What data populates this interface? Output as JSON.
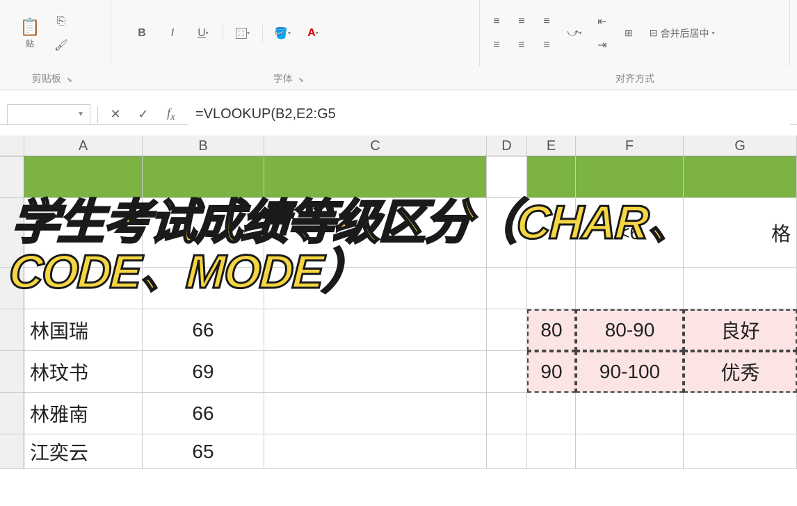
{
  "ribbon": {
    "paste_label": "贴",
    "clipboard_label": "剪贴板",
    "font_label": "字体",
    "align_label": "对齐方式",
    "bold": "B",
    "italic": "I",
    "underline": "U",
    "merge_label": "合并后居中"
  },
  "formula_bar": {
    "name_box": "",
    "formula": "=VLOOKUP(B2,E2:G5"
  },
  "columns": [
    "A",
    "B",
    "C",
    "D",
    "E",
    "F",
    "G"
  ],
  "data_rows": [
    {
      "name": "林国瑞",
      "score": "66"
    },
    {
      "name": "林玟书",
      "score": "69"
    },
    {
      "name": "林雅南",
      "score": "66"
    },
    {
      "name": "江奕云",
      "score": "65"
    }
  ],
  "lookup_table": [
    {
      "min": "80",
      "range": "80-90",
      "grade": "良好"
    },
    {
      "min": "90",
      "range": "90-100",
      "grade": "优秀"
    }
  ],
  "partial_text": {
    "lt60": "<6",
    "ge_suffix": "格"
  },
  "overlay": "学生考试成绩等级区分（CHAR、CODE、MODE）"
}
